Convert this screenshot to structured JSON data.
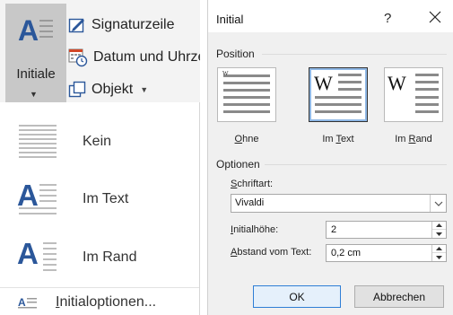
{
  "ribbon": {
    "initiale_label": "Initiale",
    "signature_label": "Signaturzeile",
    "date_label": "Datum und Uhrzeit",
    "object_label": "Objekt"
  },
  "dropdown": {
    "items": [
      {
        "label": "Kein"
      },
      {
        "label": "Im Text"
      },
      {
        "label": "Im Rand"
      }
    ],
    "options_mnemonic": "I",
    "options_rest": "nitialoptionen..."
  },
  "dialog": {
    "title": "Initial",
    "help": "?",
    "position_group": "Position",
    "positions": [
      {
        "pre": "",
        "key": "O",
        "post": "hne"
      },
      {
        "pre": "Im ",
        "key": "T",
        "post": "ext"
      },
      {
        "pre": "Im ",
        "key": "R",
        "post": "and"
      }
    ],
    "tile_letter": "W",
    "options_group": "Optionen",
    "font_label_key": "S",
    "font_label_rest": "chriftart:",
    "font_value": "Vivaldi",
    "height_label_key": "I",
    "height_label_rest": "nitialhöhe:",
    "height_value": "2",
    "distance_label_key": "A",
    "distance_label_rest": "bstand vom Text:",
    "distance_value": "0,2 cm",
    "ok_label": "OK",
    "cancel_label": "Abbrechen"
  },
  "colors": {
    "accent_blue": "#2b579a",
    "selection_blue": "#8fb8e6",
    "ok_border": "#2f7ed6"
  }
}
